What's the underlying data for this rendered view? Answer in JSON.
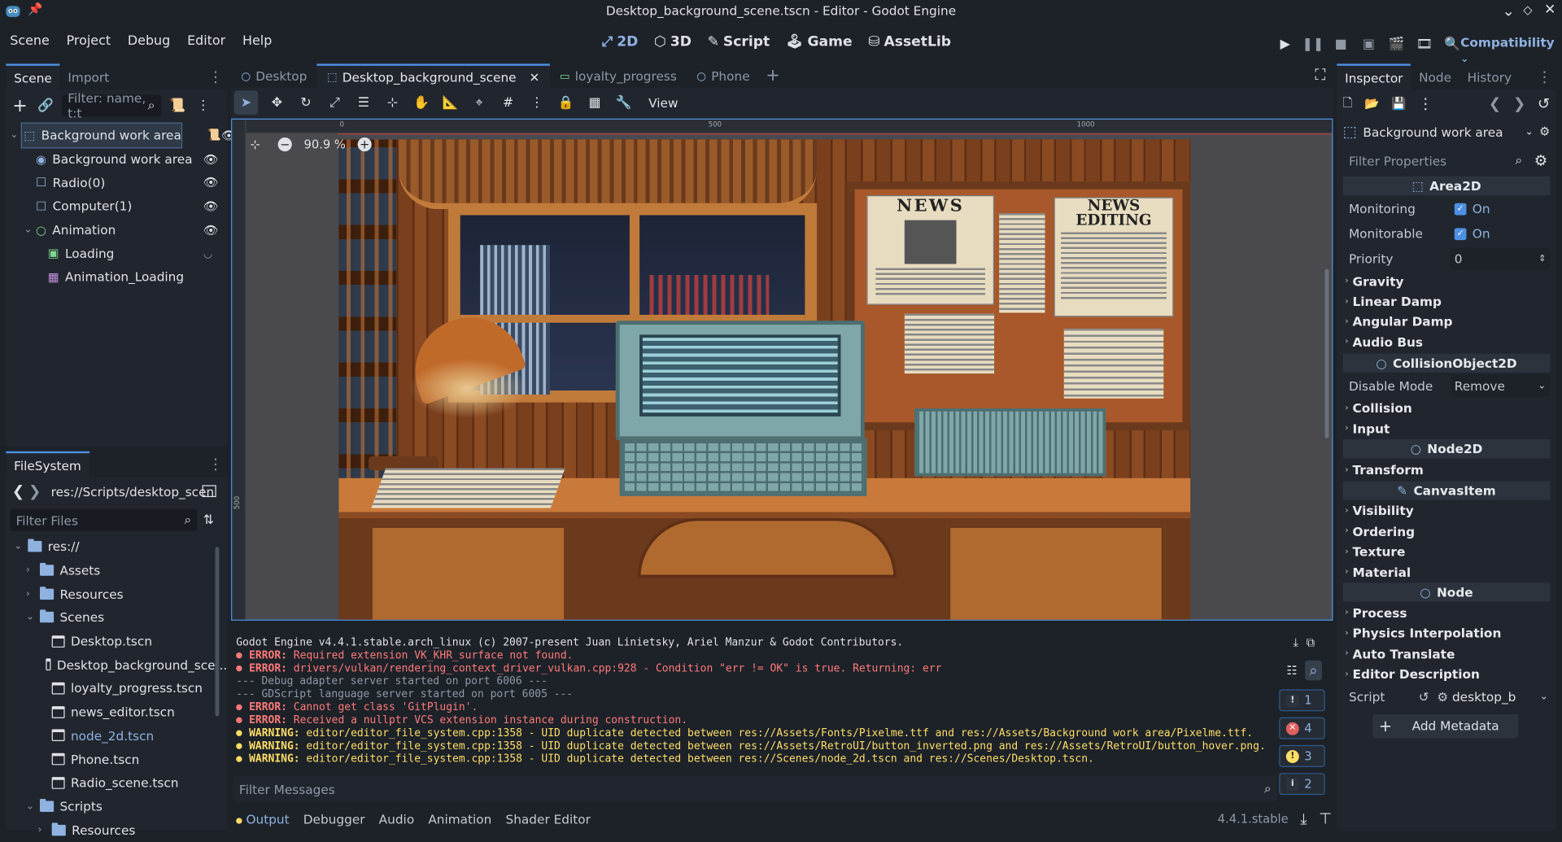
{
  "window": {
    "title": "Desktop_background_scene.tscn - Editor - Godot Engine"
  },
  "menu": [
    "Scene",
    "Project",
    "Debug",
    "Editor",
    "Help"
  ],
  "workspaces": [
    {
      "label": "2D",
      "icon": "2d-icon",
      "active": true
    },
    {
      "label": "3D",
      "icon": "3d-icon",
      "active": false
    },
    {
      "label": "Script",
      "icon": "script-icon",
      "active": false
    },
    {
      "label": "Game",
      "icon": "game-icon",
      "active": false
    },
    {
      "label": "AssetLib",
      "icon": "assetlib-icon",
      "active": false
    }
  ],
  "renderer": "Compatibility",
  "scene_dock": {
    "tabs": [
      "Scene",
      "Import"
    ],
    "filter_placeholder": "Filter: name, t:t",
    "tree": [
      {
        "label": "Background work area",
        "depth": 0,
        "icon": "area2d-icon",
        "selected": true,
        "eye": true,
        "script": true
      },
      {
        "label": "Background work area",
        "depth": 1,
        "icon": "sprite-icon",
        "eye": true
      },
      {
        "label": "Radio(0)",
        "depth": 1,
        "icon": "control-icon",
        "eye": true
      },
      {
        "label": "Computer(1)",
        "depth": 1,
        "icon": "control-icon",
        "eye": true
      },
      {
        "label": "Animation",
        "depth": 1,
        "icon": "node2d-icon",
        "eye": true,
        "expanded": true
      },
      {
        "label": "Loading",
        "depth": 2,
        "icon": "texture-rect-icon",
        "eye_closed": true
      },
      {
        "label": "Animation_Loading",
        "depth": 2,
        "icon": "animation-player-icon"
      }
    ]
  },
  "filesystem": {
    "title": "FileSystem",
    "path": "res://Scripts/desktop_scen",
    "filter_placeholder": "Filter Files",
    "items": [
      {
        "label": "res://",
        "depth": 0,
        "type": "folder",
        "open": true
      },
      {
        "label": "Assets",
        "depth": 1,
        "type": "folder"
      },
      {
        "label": "Resources",
        "depth": 1,
        "type": "folder"
      },
      {
        "label": "Scenes",
        "depth": 1,
        "type": "folder",
        "open": true
      },
      {
        "label": "Desktop.tscn",
        "depth": 2,
        "type": "file"
      },
      {
        "label": "Desktop_background_sce...",
        "depth": 2,
        "type": "file"
      },
      {
        "label": "loyalty_progress.tscn",
        "depth": 2,
        "type": "file"
      },
      {
        "label": "news_editor.tscn",
        "depth": 2,
        "type": "file"
      },
      {
        "label": "node_2d.tscn",
        "depth": 2,
        "type": "file",
        "highlight": true
      },
      {
        "label": "Phone.tscn",
        "depth": 2,
        "type": "file"
      },
      {
        "label": "Radio_scene.tscn",
        "depth": 2,
        "type": "file"
      },
      {
        "label": "Scripts",
        "depth": 1,
        "type": "folder",
        "open": true
      },
      {
        "label": "Resources",
        "depth": 2,
        "type": "folder"
      }
    ]
  },
  "editor_tabs": [
    {
      "label": "Desktop",
      "active": false
    },
    {
      "label": "Desktop_background_scene",
      "active": true
    },
    {
      "label": "loyalty_progress",
      "active": false
    },
    {
      "label": "Phone",
      "active": false
    }
  ],
  "toolbar": {
    "view_label": "View"
  },
  "viewport": {
    "zoom": "90.9 %",
    "ruler_marks": [
      "0",
      "500",
      "1000"
    ],
    "vruler_mark": "500"
  },
  "artwork": {
    "news_title_1": "NEWS",
    "news_title_2": "NEWS",
    "news_title_3": "EDITING"
  },
  "output": {
    "lines": [
      {
        "type": "plain",
        "text": "Godot Engine v4.4.1.stable.arch_linux (c) 2007-present Juan Linietsky, Ariel Manzur & Godot Contributors."
      },
      {
        "type": "error",
        "prefix": "ERROR:",
        "text": " Required extension VK_KHR_surface not found."
      },
      {
        "type": "error",
        "prefix": "ERROR:",
        "text": " drivers/vulkan/rendering_context_driver_vulkan.cpp:928 - Condition \"err != OK\" is true. Returning: err"
      },
      {
        "type": "dim",
        "text": "--- Debug adapter server started on port 6006 ---"
      },
      {
        "type": "dim",
        "text": "--- GDScript language server started on port 6005 ---"
      },
      {
        "type": "error",
        "prefix": "ERROR:",
        "text": " Cannot get class 'GitPlugin'."
      },
      {
        "type": "error",
        "prefix": "ERROR:",
        "text": " Received a nullptr VCS extension instance during construction."
      },
      {
        "type": "warning",
        "prefix": "WARNING:",
        "text": " editor/editor_file_system.cpp:1358 - UID duplicate detected between res://Assets/Fonts/Pixelme.ttf and res://Assets/Background work area/Pixelme.ttf."
      },
      {
        "type": "warning",
        "prefix": "WARNING:",
        "text": " editor/editor_file_system.cpp:1358 - UID duplicate detected between res://Assets/RetroUI/button_inverted.png and res://Assets/RetroUI/button_hover.png."
      },
      {
        "type": "warning",
        "prefix": "WARNING:",
        "text": " editor/editor_file_system.cpp:1358 - UID duplicate detected between res://Scenes/node_2d.tscn and res://Scenes/Desktop.tscn."
      }
    ],
    "filter_placeholder": "Filter Messages",
    "counts": [
      {
        "icon": "message-icon",
        "value": "1"
      },
      {
        "icon": "error-icon",
        "value": "4"
      },
      {
        "icon": "warning-icon",
        "value": "3"
      },
      {
        "icon": "info-icon",
        "value": "2"
      }
    ]
  },
  "bottom_tabs": [
    "Output",
    "Debugger",
    "Audio",
    "Animation",
    "Shader Editor"
  ],
  "version": "4.4.1.stable",
  "inspector": {
    "tabs": [
      "Inspector",
      "Node",
      "History"
    ],
    "node_name": "Background work area",
    "filter_placeholder": "Filter Properties",
    "content": [
      {
        "kind": "section",
        "label": "Area2D",
        "icon": "area2d-icon"
      },
      {
        "kind": "prop",
        "label": "Monitoring",
        "type": "check",
        "value": "On"
      },
      {
        "kind": "prop",
        "label": "Monitorable",
        "type": "check",
        "value": "On"
      },
      {
        "kind": "prop",
        "label": "Priority",
        "type": "spin",
        "value": "0"
      },
      {
        "kind": "cat",
        "label": "Gravity"
      },
      {
        "kind": "cat",
        "label": "Linear Damp"
      },
      {
        "kind": "cat",
        "label": "Angular Damp"
      },
      {
        "kind": "cat",
        "label": "Audio Bus"
      },
      {
        "kind": "section",
        "label": "CollisionObject2D",
        "icon": "circle-icon"
      },
      {
        "kind": "prop",
        "label": "Disable Mode",
        "type": "select",
        "value": "Remove"
      },
      {
        "kind": "cat",
        "label": "Collision"
      },
      {
        "kind": "cat",
        "label": "Input"
      },
      {
        "kind": "section",
        "label": "Node2D",
        "icon": "circle-icon"
      },
      {
        "kind": "cat",
        "label": "Transform"
      },
      {
        "kind": "section",
        "label": "CanvasItem",
        "icon": "pencil-icon"
      },
      {
        "kind": "cat",
        "label": "Visibility"
      },
      {
        "kind": "cat",
        "label": "Ordering"
      },
      {
        "kind": "cat",
        "label": "Texture"
      },
      {
        "kind": "cat",
        "label": "Material"
      },
      {
        "kind": "section",
        "label": "Node",
        "icon": "circle-icon"
      },
      {
        "kind": "cat",
        "label": "Process"
      },
      {
        "kind": "cat",
        "label": "Physics Interpolation"
      },
      {
        "kind": "cat",
        "label": "Auto Translate"
      },
      {
        "kind": "cat",
        "label": "Editor Description"
      }
    ],
    "script_label": "Script",
    "script_value": "desktop_b",
    "add_metadata": "Add Metadata"
  }
}
